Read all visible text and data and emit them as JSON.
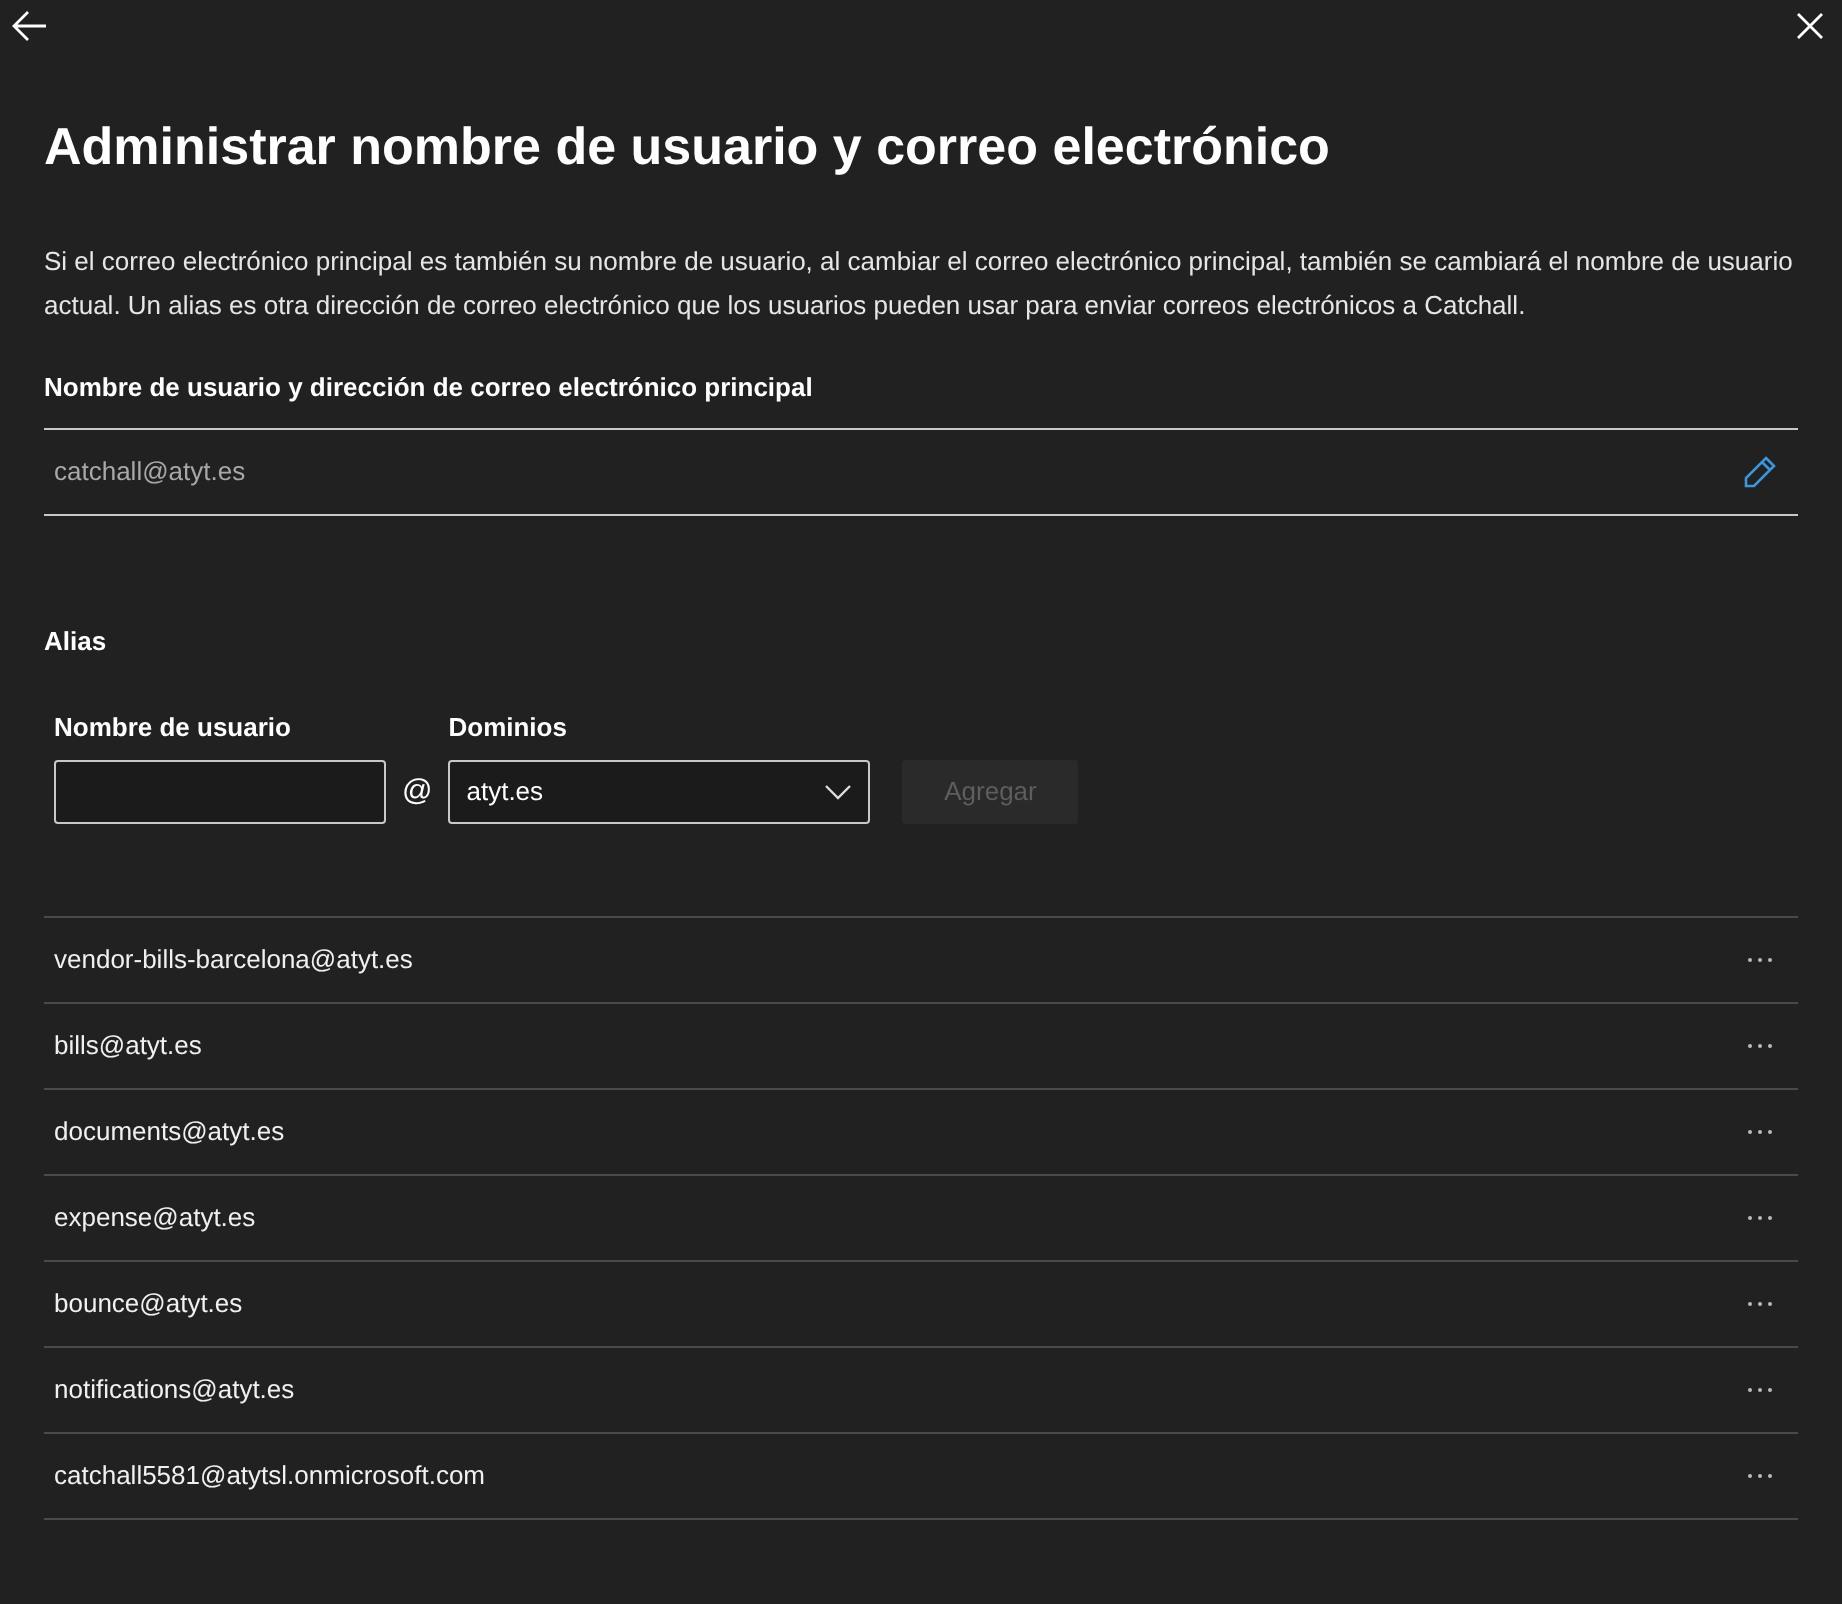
{
  "title": "Administrar nombre de usuario y correo electrónico",
  "description": "Si el correo electrónico principal es también su nombre de usuario, al cambiar el correo electrónico principal, también se cambiará el nombre de usuario actual. Un alias es otra dirección de correo electrónico que los usuarios pueden usar para enviar correos electrónicos a Catchall.",
  "primary": {
    "label": "Nombre de usuario y dirección de correo electrónico principal",
    "value": "catchall@atyt.es"
  },
  "alias": {
    "heading": "Alias",
    "username_label": "Nombre de usuario",
    "at": "@",
    "domain_label": "Dominios",
    "domain_value": "atyt.es",
    "add_button": {
      "label": "Agregar",
      "disabled": true
    }
  },
  "aliases": [
    {
      "address": "vendor-bills-barcelona@atyt.es"
    },
    {
      "address": "bills@atyt.es"
    },
    {
      "address": "documents@atyt.es"
    },
    {
      "address": "expense@atyt.es"
    },
    {
      "address": "bounce@atyt.es"
    },
    {
      "address": "notifications@atyt.es"
    },
    {
      "address": "catchall5581@atytsl.onmicrosoft.com"
    }
  ]
}
